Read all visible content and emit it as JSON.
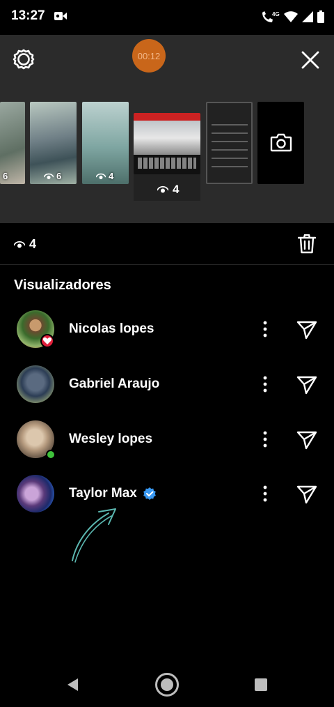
{
  "status_bar": {
    "time": "13:27",
    "network": "4G"
  },
  "story": {
    "timer_label": "00:12",
    "thumbnails": [
      {
        "count": "6"
      },
      {
        "count": "6"
      },
      {
        "count": "4"
      },
      {
        "count": "4"
      },
      {
        "count": ""
      }
    ]
  },
  "views": {
    "count": "4"
  },
  "viewers_section": {
    "title": "Visualizadores",
    "viewers": [
      {
        "name": "Nicolas lopes",
        "badge": "heart"
      },
      {
        "name": "Gabriel Araujo",
        "badge": ""
      },
      {
        "name": "Wesley lopes",
        "badge": "online"
      },
      {
        "name": "Taylor Max",
        "badge": "verified"
      }
    ]
  },
  "colors": {
    "background": "#000000",
    "top_panel": "#2b2b2b",
    "timer": "#c9661a",
    "verified": "#3897f0",
    "heart": "#e0203a",
    "online": "#3fc23b",
    "arrow": "#5bb7b0"
  },
  "icons": {
    "settings": "gear-icon",
    "close": "close-icon",
    "camera": "camera-icon",
    "delete": "trash-icon",
    "options": "more-vertical-icon",
    "share": "send-icon",
    "views": "eye-icon"
  }
}
